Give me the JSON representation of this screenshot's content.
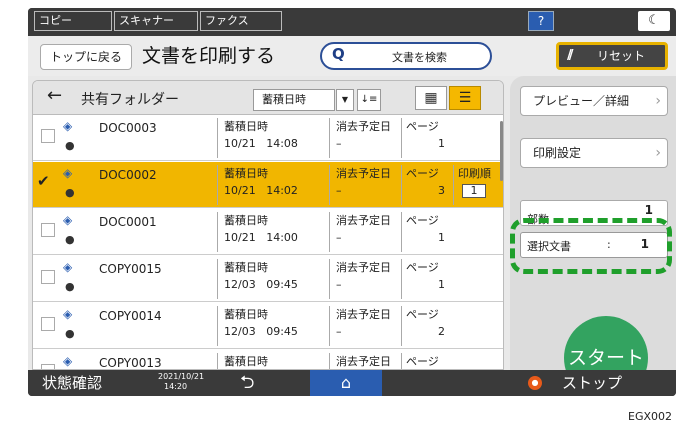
{
  "topbar": {
    "tabs": [
      "コピー",
      "スキャナー",
      "ファクス"
    ],
    "help_label": "?",
    "mode_icon": "moon-icon"
  },
  "header": {
    "back_to_top": "トップに戻る",
    "title": "文書を印刷する",
    "search_label": "文書を検索",
    "reset_label": "リセット"
  },
  "list": {
    "folder": "共有フォルダー",
    "sort_value": "蓄積日時",
    "rows": [
      {
        "name": "DOC0003",
        "stored_label": "蓄積日時",
        "date": "10/21",
        "time": "14:08",
        "del_label": "消去予定日",
        "del_value": "–",
        "page_label": "ページ",
        "pages": "1",
        "selected": false
      },
      {
        "name": "DOC0002",
        "stored_label": "蓄積日時",
        "date": "10/21",
        "time": "14:02",
        "del_label": "消去予定日",
        "del_value": "–",
        "page_label": "ページ",
        "pages": "3",
        "order_label": "印刷順",
        "order": "1",
        "selected": true
      },
      {
        "name": "DOC0001",
        "stored_label": "蓄積日時",
        "date": "10/21",
        "time": "14:00",
        "del_label": "消去予定日",
        "del_value": "–",
        "page_label": "ページ",
        "pages": "1",
        "selected": false
      },
      {
        "name": "COPY0015",
        "stored_label": "蓄積日時",
        "date": "12/03",
        "time": "09:45",
        "del_label": "消去予定日",
        "del_value": "–",
        "page_label": "ページ",
        "pages": "1",
        "selected": false
      },
      {
        "name": "COPY0014",
        "stored_label": "蓄積日時",
        "date": "12/03",
        "time": "09:45",
        "del_label": "消去予定日",
        "del_value": "–",
        "page_label": "ページ",
        "pages": "2",
        "selected": false
      },
      {
        "name": "COPY0013",
        "stored_label": "蓄積日時",
        "date": "",
        "time": "",
        "del_label": "消去予定日",
        "del_value": "",
        "page_label": "ページ",
        "pages": "",
        "selected": false
      }
    ]
  },
  "side": {
    "preview_label": "プレビュー／詳細",
    "print_settings_label": "印刷設定",
    "copies_label": "部数",
    "copies_value": "1",
    "selected_docs_label": "選択文書",
    "selected_docs_colon": ":",
    "selected_docs_value": "1",
    "start_label": "スタート"
  },
  "footer": {
    "status_label": "状態確認",
    "date": "2021/10/21",
    "time": "14:20",
    "stop_label": "ストップ"
  },
  "figure_code": "EGX002",
  "colors": {
    "accent": "#f1b600",
    "start": "#33a360",
    "highlight": "#1f9f2b",
    "home": "#2a5db0"
  }
}
